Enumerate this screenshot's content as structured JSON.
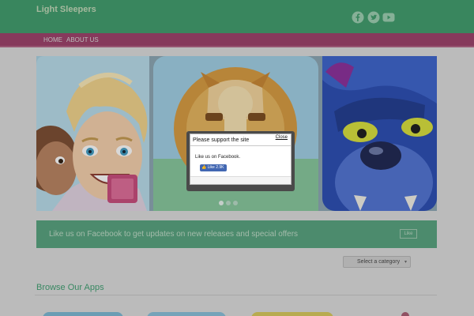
{
  "header": {
    "site_title": "Light Sleepers",
    "social_icons": [
      "facebook-icon",
      "twitter-icon",
      "youtube-icon"
    ]
  },
  "nav": {
    "items": [
      {
        "label": "HOME"
      },
      {
        "label": "ABOUT US"
      }
    ]
  },
  "slider": {
    "slides": [
      "character-faces",
      "lion-mask",
      "blue-bulldog"
    ],
    "dots": 3
  },
  "popup": {
    "title": "Please support the site",
    "close_label": "Close",
    "message": "Like us on Facebook.",
    "like_label": "Like",
    "like_count": "2.9K"
  },
  "promo": {
    "text": "Like us on Facebook to get updates on new releases and special offers",
    "button_label": "Like"
  },
  "category_select": {
    "selected": "Select a category"
  },
  "browse": {
    "heading": "Browse Our Apps"
  },
  "colors": {
    "header_green": "#3d9b6b",
    "nav_magenta": "#9c3f68",
    "promo_green": "#55a27d",
    "facebook_blue": "#4267b2"
  }
}
